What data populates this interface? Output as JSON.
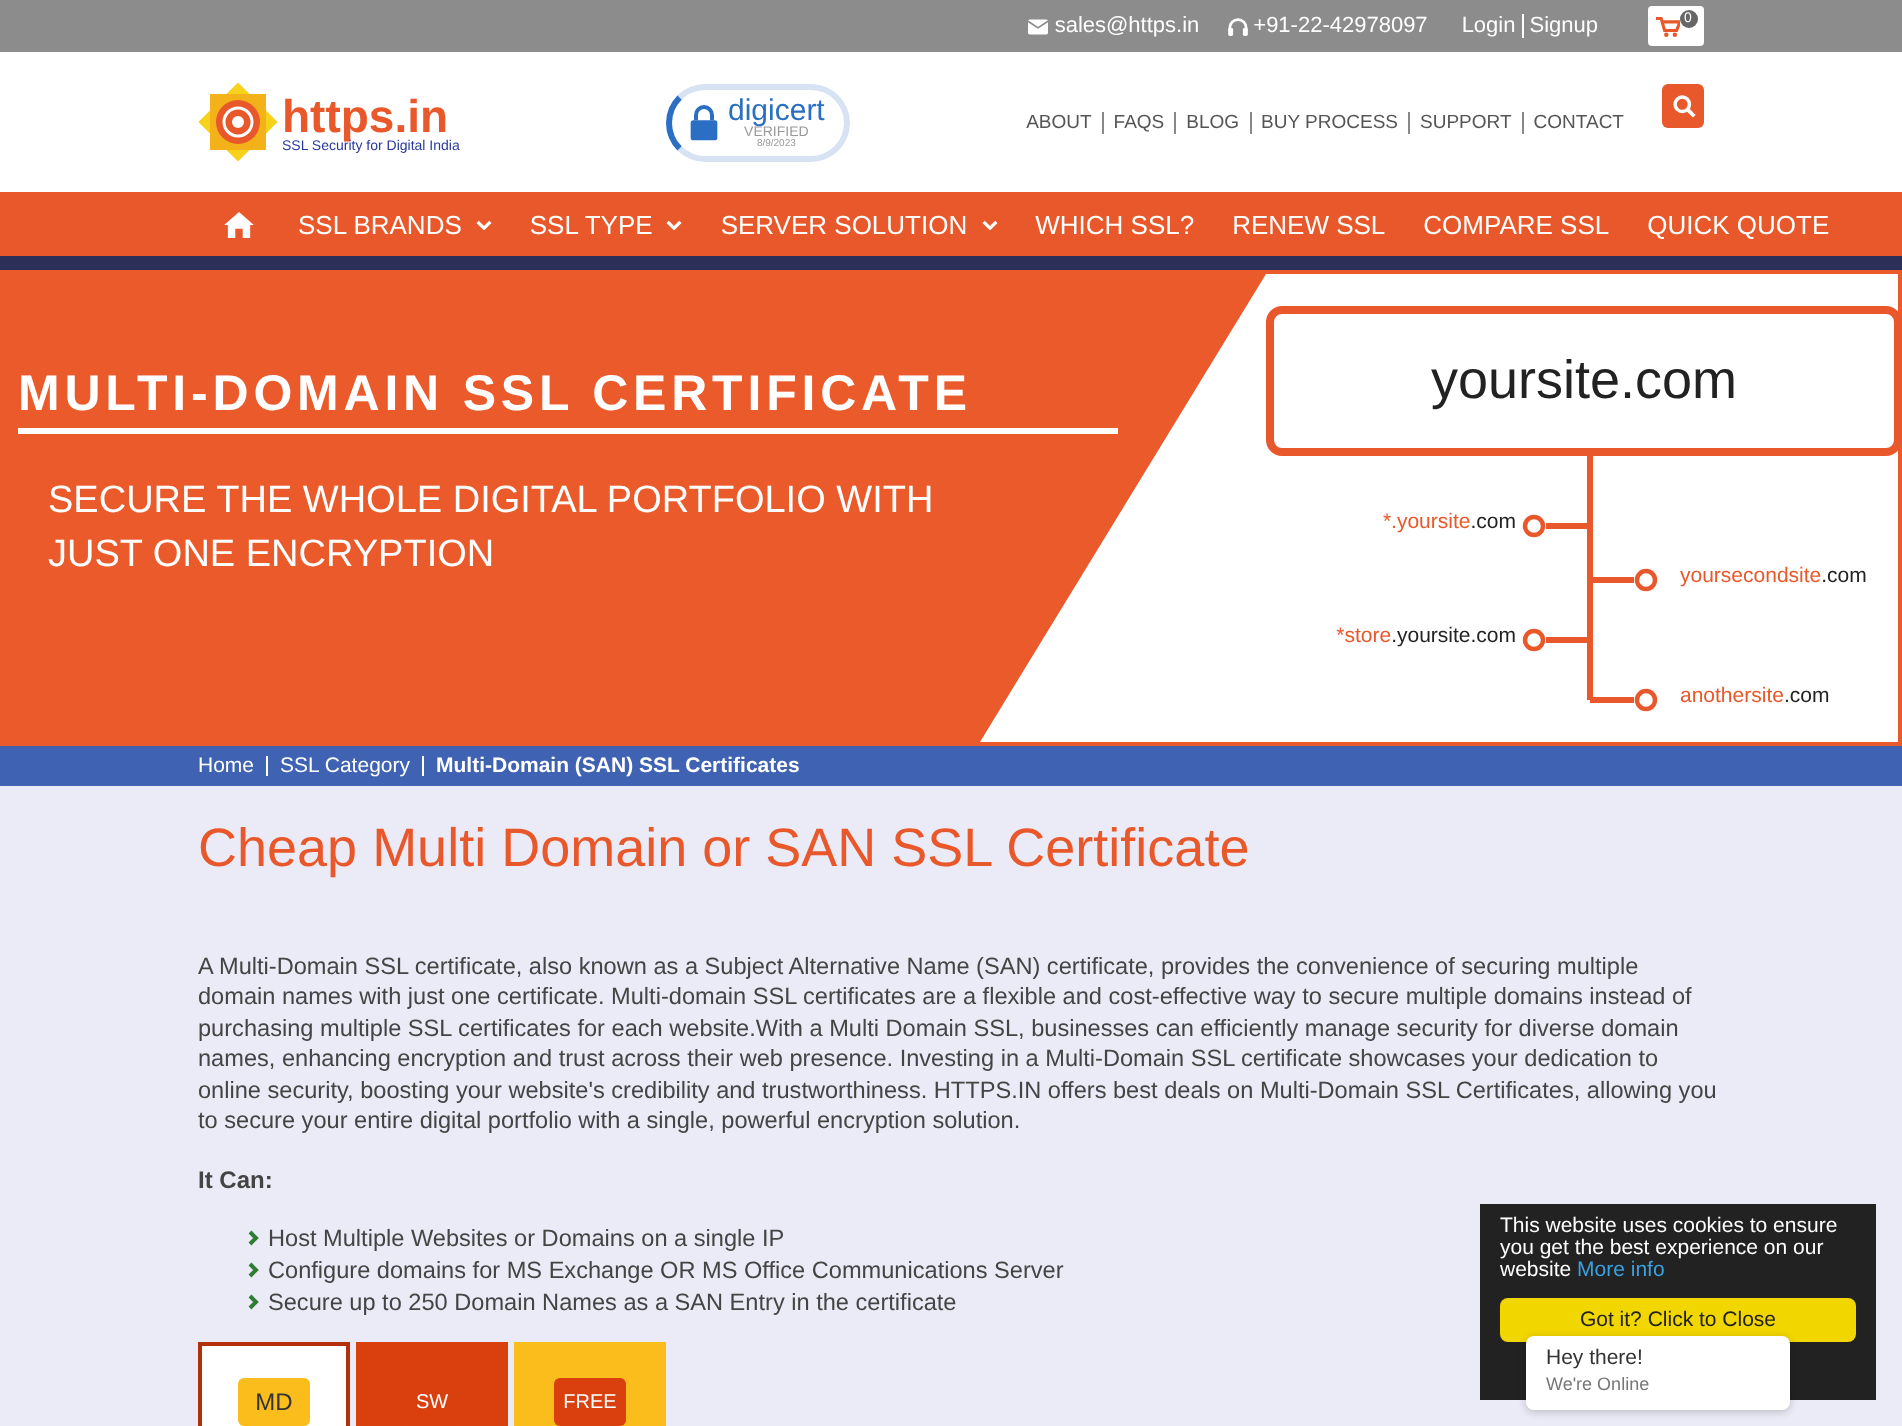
{
  "top_bar": {
    "email": "sales@https.in",
    "phone": "+91-22-42978097",
    "links": [
      "Login",
      "Signup"
    ],
    "cart_count": "0"
  },
  "header": {
    "logo_text": "https.in",
    "logo_tagline": "SSL Security for Digital India",
    "seal": {
      "brand": "digicert",
      "status": "VERIFIED",
      "date": "8/9/2023"
    },
    "links": [
      "ABOUT",
      "FAQS",
      "BLOG",
      "BUY PROCESS",
      "SUPPORT",
      "CONTACT"
    ]
  },
  "nav": [
    {
      "label": "SSL BRANDS",
      "has_menu": true
    },
    {
      "label": "SSL TYPE",
      "has_menu": true
    },
    {
      "label": "SERVER SOLUTION",
      "has_menu": true
    },
    {
      "label": "WHICH SSL?",
      "has_menu": false
    },
    {
      "label": "RENEW SSL",
      "has_menu": false
    },
    {
      "label": "COMPARE SSL",
      "has_menu": false
    },
    {
      "label": "QUICK QUOTE",
      "has_menu": false
    }
  ],
  "banner": {
    "title": "MULTI-DOMAIN SSL CERTIFICATE",
    "subtitle": "SECURE THE WHOLE DIGITAL PORTFOLIO WITH JUST ONE ENCRYPTION",
    "main_domain": "yoursite.com",
    "domains": [
      {
        "kind": "left",
        "highlight": "*.yoursite",
        "rest": ".com"
      },
      {
        "kind": "right",
        "highlight": "yoursecondsite",
        "rest": ".com"
      },
      {
        "kind": "left",
        "highlight": "*store",
        "rest": ".yoursite.com"
      },
      {
        "kind": "right",
        "highlight": "anothersite",
        "rest": ".com"
      }
    ]
  },
  "breadcrumb": [
    {
      "label": "Home",
      "current": false
    },
    {
      "label": "SSL Category",
      "current": false
    },
    {
      "label": "Multi-Domain (SAN) SSL Certificates",
      "current": true
    }
  ],
  "content": {
    "heading": "Cheap Multi Domain or SAN SSL Certificate",
    "paragraph": "A Multi-Domain SSL certificate, also known as a Subject Alternative Name (SAN) certificate, provides the convenience of securing multiple domain names with just one certificate. Multi-domain SSL certificates are a flexible and cost-effective way to secure multiple domains instead of purchasing multiple SSL certificates for each website.With a Multi Domain SSL, businesses can efficiently manage security for diverse domain names, enhancing encryption and trust across their web presence. Investing in a Multi-Domain SSL certificate showcases your dedication to online security, boosting your website's credibility and trustworthiness. HTTPS.IN offers best deals on Multi-Domain SSL Certificates, allowing you to secure your entire digital portfolio with a single, powerful encryption solution.",
    "list_title": "It Can:",
    "list": [
      "Host Multiple Websites or Domains on a single IP",
      "Configure domains for MS Exchange OR MS Office Communications Server",
      "Secure up to 250 Domain Names as a SAN Entry in the certificate"
    ],
    "tiles": [
      {
        "label": "MD",
        "color": "#ffffff",
        "selected": true
      },
      {
        "label": "SW",
        "color": "#d9400e",
        "selected": false
      },
      {
        "label": "FREE",
        "color": "#fbbd1b",
        "selected": false
      }
    ]
  },
  "cookie_notice": {
    "text": "This website uses cookies to ensure you get the best experience on our website",
    "link": "More info",
    "button": "Got it? Click to Close"
  },
  "chat": {
    "title": "Hey there!",
    "status": "We're Online"
  }
}
